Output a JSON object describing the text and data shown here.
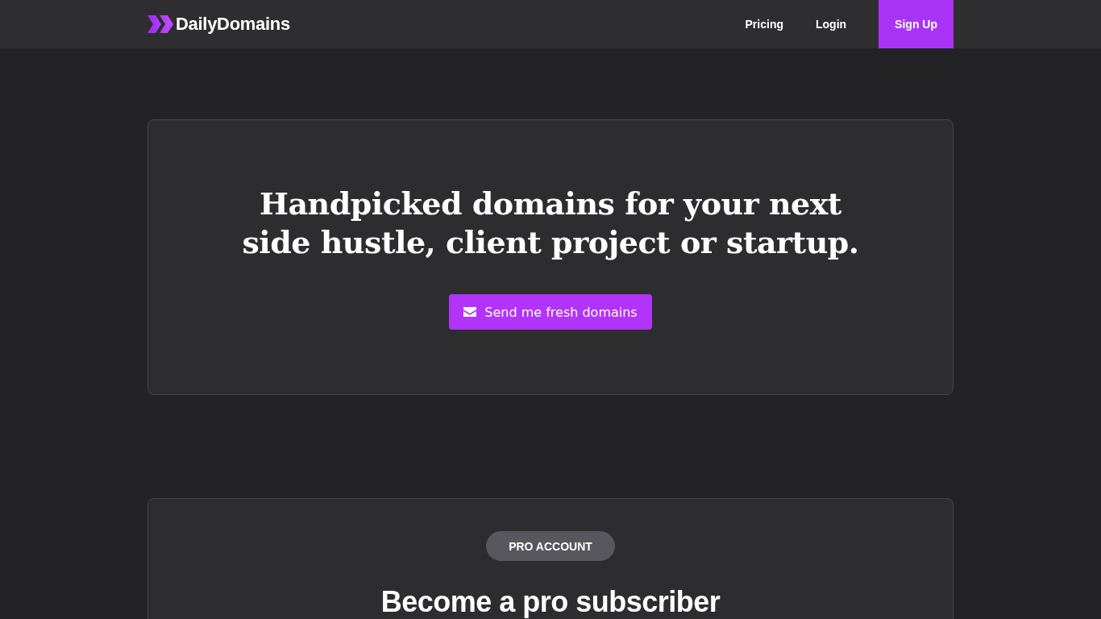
{
  "header": {
    "logo": "DailyDomains",
    "nav": [
      {
        "label": "Pricing",
        "kind": "link"
      },
      {
        "label": "Login",
        "kind": "link"
      },
      {
        "label": "Sign Up",
        "kind": "primary"
      }
    ]
  },
  "hero": {
    "headline": "Handpicked domains for your next side hustle, client project or startup.",
    "button": "Send me fresh domains"
  },
  "pro": {
    "badge": "PRO ACCOUNT",
    "title": "Become a pro subscriber"
  }
}
